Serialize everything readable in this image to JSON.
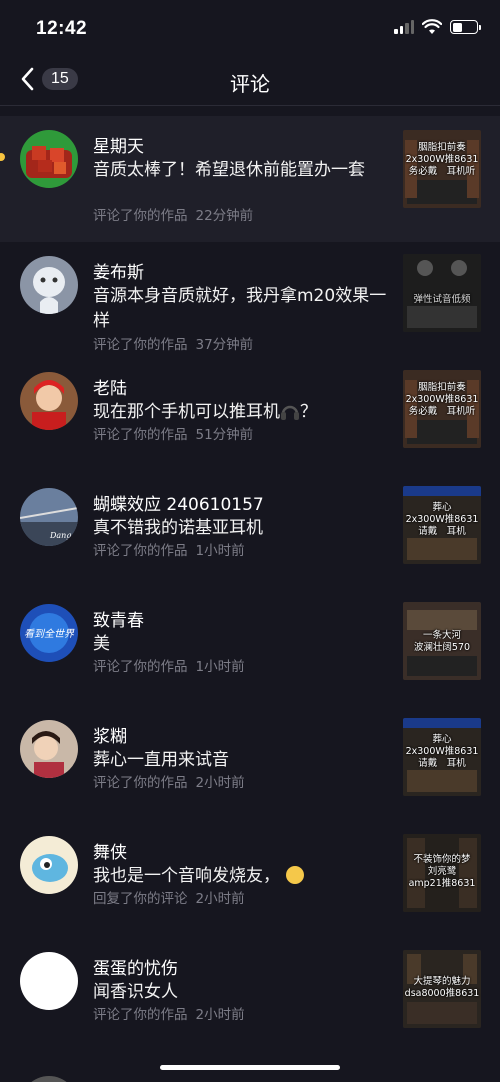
{
  "status_bar": {
    "time": "12:42"
  },
  "nav": {
    "back_count": "15",
    "title": "评论"
  },
  "items": [
    {
      "name": "星期天",
      "comment": "音质太棒了！希望退休前能置办一套",
      "action": "评论了你的作品",
      "time": "22分钟前",
      "thumb_caption": "胭脂扣前奏\n2x300W推8631\n务必戴　耳机听",
      "unread": true
    },
    {
      "name": "姜布斯",
      "comment": "音源本身音质就好，我丹拿m20效果一样",
      "action": "评论了你的作品",
      "time": "37分钟前",
      "thumb_caption": "弹性试音低频"
    },
    {
      "name": "老陆",
      "comment": "现在那个手机可以推耳机",
      "comment_suffix": "？",
      "action": "评论了你的作品",
      "time": "51分钟前",
      "thumb_caption": "胭脂扣前奏\n2x300W推8631\n务必戴　耳机听"
    },
    {
      "name": "蝴蝶效应 240610157",
      "comment": "真不错我的诺基亚耳机",
      "action": "评论了你的作品",
      "time": "1小时前",
      "thumb_caption": "葬心\n2x300W推8631\n请戴　耳机"
    },
    {
      "name": "致青春",
      "comment": "美",
      "action": "评论了你的作品",
      "time": "1小时前",
      "thumb_caption": "一条大河\n波澜壮阔570"
    },
    {
      "name": "浆糊",
      "comment": "葬心一直用来试音",
      "action": "评论了你的作品",
      "time": "2小时前",
      "thumb_caption": "葬心\n2x300W推8631\n请戴　耳机"
    },
    {
      "name": "舞侠",
      "comment": "我也是一个音响发烧友，",
      "action": "回复了你的评论",
      "time": "2小时前",
      "thumb_caption": "不装饰你的梦\n刘亮鹭\namp21推8631"
    },
    {
      "name": "蛋蛋的忧伤",
      "comment": "闻香识女人",
      "action": "评论了你的作品",
      "time": "2小时前",
      "thumb_caption": "大提琴的魅力\ndsa8000推8631"
    }
  ],
  "avatar_text": {
    "item5": "看到全世界",
    "item4": "Dangoo"
  },
  "colors": {
    "background": "#16161f",
    "highlight_row": "#1f1f29",
    "meta_text": "#7d7d88",
    "unread_dot": "#f6c33f"
  }
}
